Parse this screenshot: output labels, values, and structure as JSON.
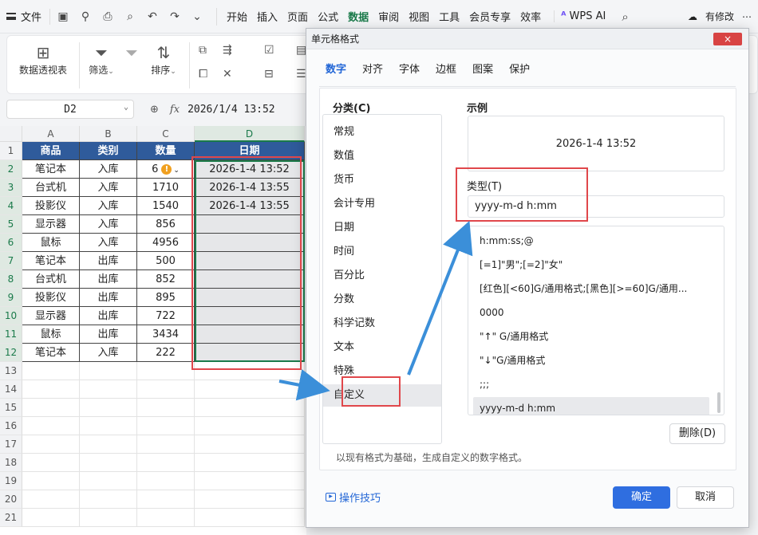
{
  "menubar": {
    "file_label": "文件",
    "tabs": [
      "开始",
      "插入",
      "页面",
      "公式",
      "数据",
      "审阅",
      "视图",
      "工具",
      "会员专享",
      "效率"
    ],
    "active_tab": "数据",
    "wps_ai": "WPS AI",
    "modified": "有修改"
  },
  "ribbon": {
    "pivot": "数据透视表",
    "filter": "筛选",
    "sort": "排序"
  },
  "formula_bar": {
    "name_box": "D2",
    "fx": "fx",
    "content": "2026/1/4 13:52"
  },
  "sheet": {
    "columns": [
      "A",
      "B",
      "C",
      "D"
    ],
    "selected_column": "D",
    "rows": [
      "1",
      "2",
      "3",
      "4",
      "5",
      "6",
      "7",
      "8",
      "9",
      "10",
      "11",
      "12",
      "13",
      "14",
      "15",
      "16",
      "17",
      "18",
      "19",
      "20",
      "21"
    ],
    "header": [
      "商品",
      "类别",
      "数量",
      "日期"
    ],
    "data": [
      [
        "笔记本",
        "入库",
        "6",
        "2026-1-4 13:52"
      ],
      [
        "台式机",
        "入库",
        "1710",
        "2026-1-4 13:55"
      ],
      [
        "投影仪",
        "入库",
        "1540",
        "2026-1-4 13:55"
      ],
      [
        "显示器",
        "入库",
        "856",
        ""
      ],
      [
        "鼠标",
        "入库",
        "4956",
        ""
      ],
      [
        "笔记本",
        "出库",
        "500",
        ""
      ],
      [
        "台式机",
        "出库",
        "852",
        ""
      ],
      [
        "投影仪",
        "出库",
        "895",
        ""
      ],
      [
        "显示器",
        "出库",
        "722",
        ""
      ],
      [
        "鼠标",
        "出库",
        "3434",
        ""
      ],
      [
        "笔记本",
        "入库",
        "222",
        ""
      ]
    ]
  },
  "dialog": {
    "title": "单元格格式",
    "close": "×",
    "tabs": [
      "数字",
      "对齐",
      "字体",
      "边框",
      "图案",
      "保护"
    ],
    "active_tab": "数字",
    "category_label": "分类(C)",
    "categories": [
      "常规",
      "数值",
      "货币",
      "会计专用",
      "日期",
      "时间",
      "百分比",
      "分数",
      "科学记数",
      "文本",
      "特殊",
      "自定义"
    ],
    "selected_category": "自定义",
    "sample_label": "示例",
    "sample_value": "2026-1-4 13:52",
    "type_label": "类型(T)",
    "type_value": "yyyy-m-d h:mm",
    "formats": [
      "h:mm:ss;@",
      "[=1]\"男\";[=2]\"女\"",
      "[红色][<60]G/通用格式;[黑色][>=60]G/通用...",
      "0000",
      "\"↑\" G/通用格式",
      "\"↓\"G/通用格式",
      ";;;",
      "yyyy-m-d h:mm"
    ],
    "selected_format": "yyyy-m-d h:mm",
    "delete_button": "删除(D)",
    "hint": "以现有格式为基础，生成自定义的数字格式。",
    "tips": "操作技巧",
    "ok": "确定",
    "cancel": "取消"
  },
  "colors": {
    "header_fill": "#2f5b9b",
    "accent_green": "#1a7a4a",
    "annotation_red": "#e0474b",
    "arrow_blue": "#3b8fd9",
    "primary_blue": "#2f6ee0"
  }
}
